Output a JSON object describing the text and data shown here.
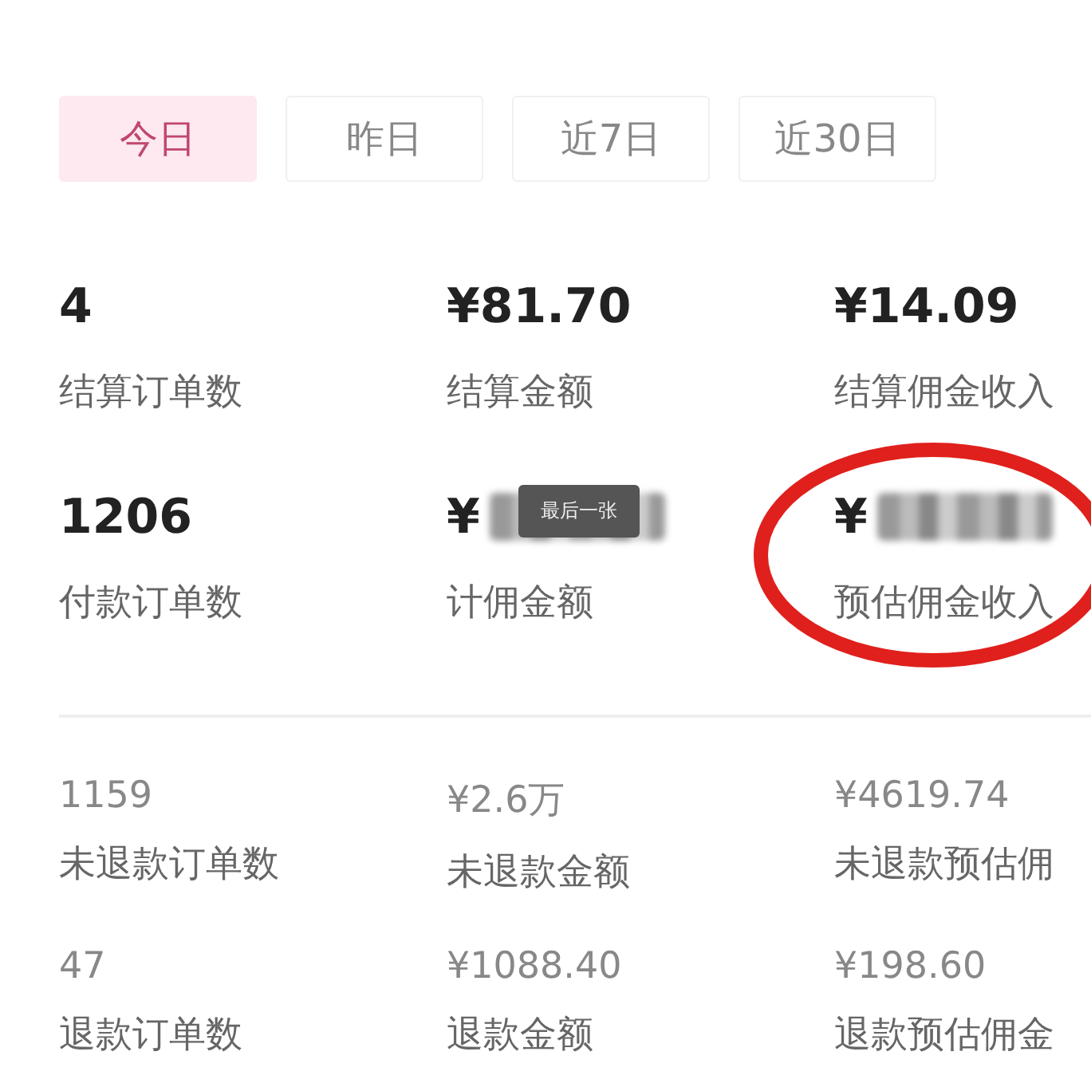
{
  "tabs": [
    {
      "label": "今日",
      "selected": true
    },
    {
      "label": "昨日",
      "selected": false
    },
    {
      "label": "近7日",
      "selected": false
    },
    {
      "label": "近30日",
      "selected": false
    }
  ],
  "primary_stats": [
    {
      "value": "4",
      "label": "结算订单数"
    },
    {
      "value": "¥81.70",
      "label": "结算金额"
    },
    {
      "value": "¥14.09",
      "label": "结算佣金收入"
    },
    {
      "value": "1206",
      "label": "付款订单数"
    },
    {
      "value": "¥",
      "label": "计佣金额",
      "masked": true,
      "tooltip": "最后一张"
    },
    {
      "value": "¥",
      "label": "预估佣金收入",
      "masked": true,
      "circled": true
    }
  ],
  "secondary_stats": [
    {
      "value": "1159",
      "label": "未退款订单数"
    },
    {
      "value": "¥2.6万",
      "label": "未退款金额"
    },
    {
      "value": "¥4619.74",
      "label": "未退款预估佣"
    },
    {
      "value": "47",
      "label": "退款订单数"
    },
    {
      "value": "¥1088.40",
      "label": "退款金额"
    },
    {
      "value": "¥198.60",
      "label": "退款预估佣金"
    }
  ]
}
